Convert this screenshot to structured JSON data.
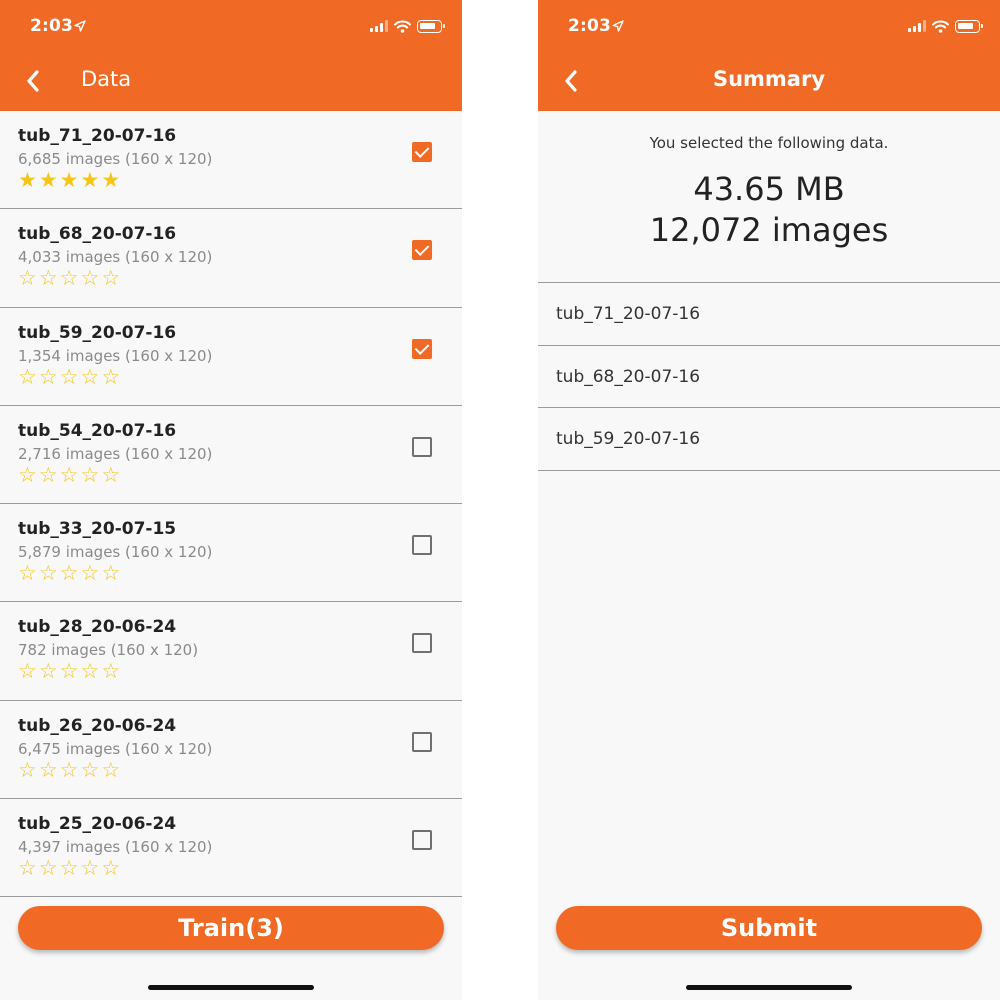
{
  "left_screen": {
    "status": {
      "time": "2:03"
    },
    "nav": {
      "title": "Data"
    },
    "items": [
      {
        "name": "tub_71_20-07-16",
        "meta": "6,685 images (160 x 120)",
        "rating": 5,
        "checked": true
      },
      {
        "name": "tub_68_20-07-16",
        "meta": "4,033 images (160 x 120)",
        "rating": 0,
        "checked": true
      },
      {
        "name": "tub_59_20-07-16",
        "meta": "1,354 images (160 x 120)",
        "rating": 0,
        "checked": true
      },
      {
        "name": "tub_54_20-07-16",
        "meta": "2,716 images (160 x 120)",
        "rating": 0,
        "checked": false
      },
      {
        "name": "tub_33_20-07-15",
        "meta": "5,879 images (160 x 120)",
        "rating": 0,
        "checked": false
      },
      {
        "name": "tub_28_20-06-24",
        "meta": "782 images (160 x 120)",
        "rating": 0,
        "checked": false
      },
      {
        "name": "tub_26_20-06-24",
        "meta": "6,475 images (160 x 120)",
        "rating": 0,
        "checked": false
      },
      {
        "name": "tub_25_20-06-24",
        "meta": "4,397 images (160 x 120)",
        "rating": 0,
        "checked": false
      }
    ],
    "action_label": "Train(3)"
  },
  "right_screen": {
    "status": {
      "time": "2:03"
    },
    "nav": {
      "title": "Summary"
    },
    "subtitle": "You selected the following data.",
    "total_size": "43.65 MB",
    "total_images": "12,072 images",
    "selected": [
      "tub_71_20-07-16",
      "tub_68_20-07-16",
      "tub_59_20-07-16"
    ],
    "action_label": "Submit"
  },
  "colors": {
    "accent": "#f06a25",
    "star": "#f5c518",
    "background": "#f8f8f8"
  },
  "icons": {
    "back": "chevron-left-icon",
    "location": "location-arrow-icon",
    "signal": "cellular-signal-icon",
    "wifi": "wifi-icon",
    "battery": "battery-icon",
    "star_filled": "star-filled-icon",
    "star_empty": "star-outline-icon",
    "checkbox": "checkbox-icon"
  }
}
